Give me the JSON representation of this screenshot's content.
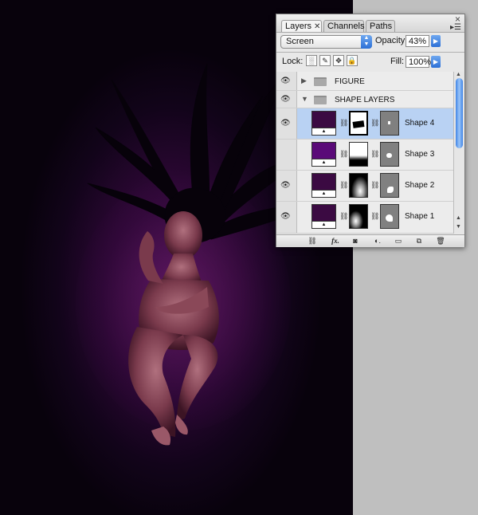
{
  "panel": {
    "tabs": [
      {
        "label": "Layers",
        "close": "✕"
      },
      {
        "label": "Channels"
      },
      {
        "label": "Paths"
      }
    ],
    "blend_mode": "Screen",
    "opacity_label": "Opacity:",
    "opacity_value": "43%",
    "lock_label": "Lock:",
    "fill_label": "Fill:",
    "fill_value": "100%"
  },
  "layers": {
    "groups": [
      {
        "name": "FIGURE",
        "expanded": false
      },
      {
        "name": "SHAPE LAYERS",
        "expanded": true
      }
    ],
    "items": [
      {
        "name": "Shape 4",
        "selected": true
      },
      {
        "name": "Shape 3",
        "selected": false
      },
      {
        "name": "Shape 2",
        "selected": false
      },
      {
        "name": "Shape 1",
        "selected": false
      }
    ]
  },
  "colors": {
    "canvas_bg": "#12041a",
    "layer_fill_dark": "#3b0a42",
    "layer_fill_purple": "#5a0a78",
    "selection": "#b9d2f3",
    "accent": "#2b6fd6"
  },
  "icons": {
    "eye": "eye-icon",
    "folder": "folder-icon",
    "link": "link-icon",
    "fx": "fx-icon",
    "trash": "trash-icon"
  }
}
